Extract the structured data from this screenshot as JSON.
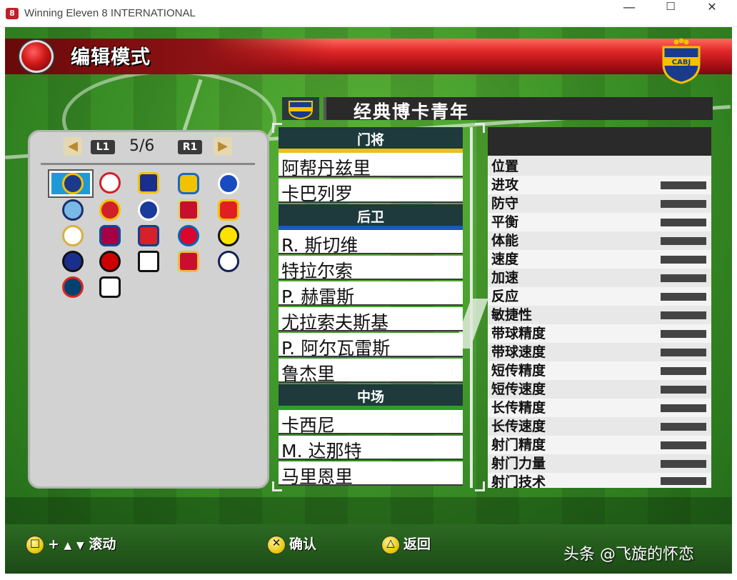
{
  "window": {
    "title": "Winning Eleven 8 INTERNATIONAL",
    "min_label": "—",
    "max_label": "☐",
    "close_label": "✕"
  },
  "header": {
    "title": "编辑模式"
  },
  "team_selector": {
    "prev_label": "◀",
    "next_label": "▶",
    "l1_label": "L1",
    "r1_label": "R1",
    "page": "5/6"
  },
  "team": {
    "name": "经典博卡青年",
    "crest_text": "CABJ"
  },
  "roster": {
    "groups": [
      {
        "position": "门将",
        "players": [
          "阿帮丹兹里",
          "卡巴列罗"
        ]
      },
      {
        "position": "后卫",
        "players": [
          "R. 斯切维",
          "特拉尔索",
          "P. 赫雷斯",
          "尤拉索夫斯基",
          "P. 阿尔瓦雷斯",
          "鲁杰里"
        ]
      },
      {
        "position": "中场",
        "players": [
          "卡西尼",
          "M. 达那特",
          "马里恩里"
        ]
      }
    ]
  },
  "stats": {
    "labels": [
      "位置",
      "进攻",
      "防守",
      "平衡",
      "体能",
      "速度",
      "加速",
      "反应",
      "敏捷性",
      "带球精度",
      "带球速度",
      "短传精度",
      "短传速度",
      "长传精度",
      "长传速度",
      "射门精度",
      "射门力量",
      "射门技术"
    ]
  },
  "footer": {
    "scroll_plus": "+",
    "scroll_up": "▲",
    "scroll_down": "▼",
    "scroll_label": "滚动",
    "confirm_label": "确认",
    "back_label": "返回",
    "square_symbol": "□",
    "cross_symbol": "✕",
    "triangle_symbol": "△"
  },
  "watermark": "头条 @飞旋的怀恋",
  "colors": {
    "header_red": "#e0282a",
    "pitch_green": "#3d9428",
    "goalkeeper_stripe": "#e6c21a",
    "defender_stripe": "#1c58b8",
    "midfielder_stripe": "#2aa028"
  }
}
